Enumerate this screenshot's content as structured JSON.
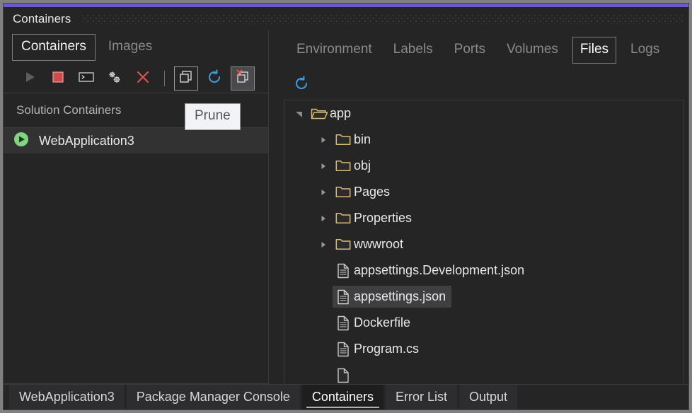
{
  "window": {
    "title": "Containers",
    "accent_color": "#6a5acd"
  },
  "left_panel": {
    "subtabs": [
      {
        "label": "Containers",
        "selected": true
      },
      {
        "label": "Images",
        "selected": false
      }
    ],
    "toolbar": [
      {
        "name": "run-button",
        "icon": "play-icon",
        "state": "disabled"
      },
      {
        "name": "stop-button",
        "icon": "stop-icon",
        "state": "enabled"
      },
      {
        "name": "terminal-button",
        "icon": "terminal-icon",
        "state": "enabled"
      },
      {
        "name": "settings-button",
        "icon": "gears-icon",
        "state": "enabled"
      },
      {
        "name": "remove-button",
        "icon": "close-x-icon",
        "state": "enabled"
      },
      {
        "name": "separator",
        "icon": "separator",
        "state": "static"
      },
      {
        "name": "show-all-button",
        "icon": "stacked-windows-icon",
        "state": "framed"
      },
      {
        "name": "refresh-button",
        "icon": "refresh-icon",
        "state": "enabled"
      },
      {
        "name": "prune-button",
        "icon": "prune-icon",
        "state": "hovered"
      }
    ],
    "section_label": "Solution Containers",
    "containers": [
      {
        "name": "WebApplication3",
        "status": "running",
        "selected": true
      }
    ]
  },
  "tooltip": {
    "text": "Prune",
    "visible": true
  },
  "right_panel": {
    "tabs": [
      {
        "label": "Environment",
        "selected": false
      },
      {
        "label": "Labels",
        "selected": false
      },
      {
        "label": "Ports",
        "selected": false
      },
      {
        "label": "Volumes",
        "selected": false
      },
      {
        "label": "Files",
        "selected": true
      },
      {
        "label": "Logs",
        "selected": false
      }
    ],
    "toolbar": [
      {
        "name": "refresh-files-button",
        "icon": "refresh-icon"
      }
    ],
    "file_tree": [
      {
        "label": "app",
        "type": "folder-open",
        "depth": 0,
        "expanded": true,
        "selected": false
      },
      {
        "label": "bin",
        "type": "folder",
        "depth": 1,
        "expanded": false,
        "selected": false
      },
      {
        "label": "obj",
        "type": "folder",
        "depth": 1,
        "expanded": false,
        "selected": false
      },
      {
        "label": "Pages",
        "type": "folder",
        "depth": 1,
        "expanded": false,
        "selected": false
      },
      {
        "label": "Properties",
        "type": "folder",
        "depth": 1,
        "expanded": false,
        "selected": false
      },
      {
        "label": "wwwroot",
        "type": "folder",
        "depth": 1,
        "expanded": false,
        "selected": false
      },
      {
        "label": "appsettings.Development.json",
        "type": "file",
        "depth": 1,
        "expanded": false,
        "selected": false
      },
      {
        "label": "appsettings.json",
        "type": "file",
        "depth": 1,
        "expanded": false,
        "selected": true
      },
      {
        "label": "Dockerfile",
        "type": "file",
        "depth": 1,
        "expanded": false,
        "selected": false
      },
      {
        "label": "Program.cs",
        "type": "file",
        "depth": 1,
        "expanded": false,
        "selected": false
      },
      {
        "label": "",
        "type": "file",
        "depth": 1,
        "expanded": false,
        "selected": false
      }
    ]
  },
  "bottom_tabs": [
    {
      "label": "WebApplication3",
      "selected": false
    },
    {
      "label": "Package Manager Console",
      "selected": false
    },
    {
      "label": "Containers",
      "selected": true
    },
    {
      "label": "Error List",
      "selected": false
    },
    {
      "label": "Output",
      "selected": false
    }
  ],
  "colors": {
    "accent": "#6a5acd",
    "folder": "#dcb67a",
    "running": "#7fd67f",
    "stop": "#d9534f",
    "refresh": "#3b9bdd",
    "selection": "#3f3f41"
  }
}
